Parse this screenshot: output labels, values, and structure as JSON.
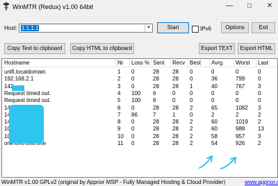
{
  "window": {
    "title": "WinMTR (Redux) v1.00 64bit"
  },
  "toolbar": {
    "host_label": "Host:",
    "host_value": "1.1.1.1",
    "start": "Start",
    "ipv6": "IPv6",
    "options": "Options",
    "exit": "Exit",
    "copy_text": "Copy Text to clipboard",
    "copy_html": "Copy HTML to clipboard",
    "export_text": "Export TEXT",
    "export_html": "Export HTML"
  },
  "table": {
    "columns": [
      "Hostname",
      "Nr",
      "Loss %",
      "Sent",
      "Recv",
      "Best",
      "Avrg",
      "Worst",
      "Last"
    ],
    "rows": [
      [
        "unifi.localdomain",
        "1",
        "0",
        "28",
        "28",
        "0",
        "0",
        "0",
        "0"
      ],
      [
        "192.168.2.1",
        "2",
        "0",
        "28",
        "28",
        "0",
        "36",
        "799",
        "0"
      ],
      [
        "142.",
        "3",
        "0",
        "28",
        "28",
        "1",
        "40",
        "767",
        "3"
      ],
      [
        "Request timed out.",
        "4",
        "100",
        "6",
        "0",
        "0",
        "0",
        "0",
        "0"
      ],
      [
        "Request timed out.",
        "5",
        "100",
        "6",
        "0",
        "0",
        "0",
        "0",
        "0"
      ],
      [
        "14",
        "6",
        "0",
        "28",
        "28",
        "2",
        "65",
        "1082",
        "3"
      ],
      [
        "142.",
        "7",
        "86",
        "7",
        "1",
        "0",
        "2",
        "2",
        "2"
      ],
      [
        "142.",
        "8",
        "0",
        "28",
        "28",
        "2",
        "60",
        "1019",
        "2"
      ],
      [
        "108.",
        "9",
        "0",
        "28",
        "28",
        "2",
        "60",
        "988",
        "13"
      ],
      [
        "108.",
        "10",
        "0",
        "28",
        "28",
        "2",
        "58",
        "957",
        "3"
      ],
      [
        "one.one.one.one",
        "11",
        "0",
        "28",
        "28",
        "2",
        "54",
        "926",
        "2"
      ]
    ]
  },
  "status": {
    "text": "WinMTR v1.00 GPLv2 (original by Appnor MSP - Fully Managed Hosting & Cloud Provider)",
    "link": "www.appnor.com"
  },
  "colors": {
    "redaction": "#2ec5ee",
    "annotation": "#2ec5ee",
    "selection": "#0078d7"
  }
}
